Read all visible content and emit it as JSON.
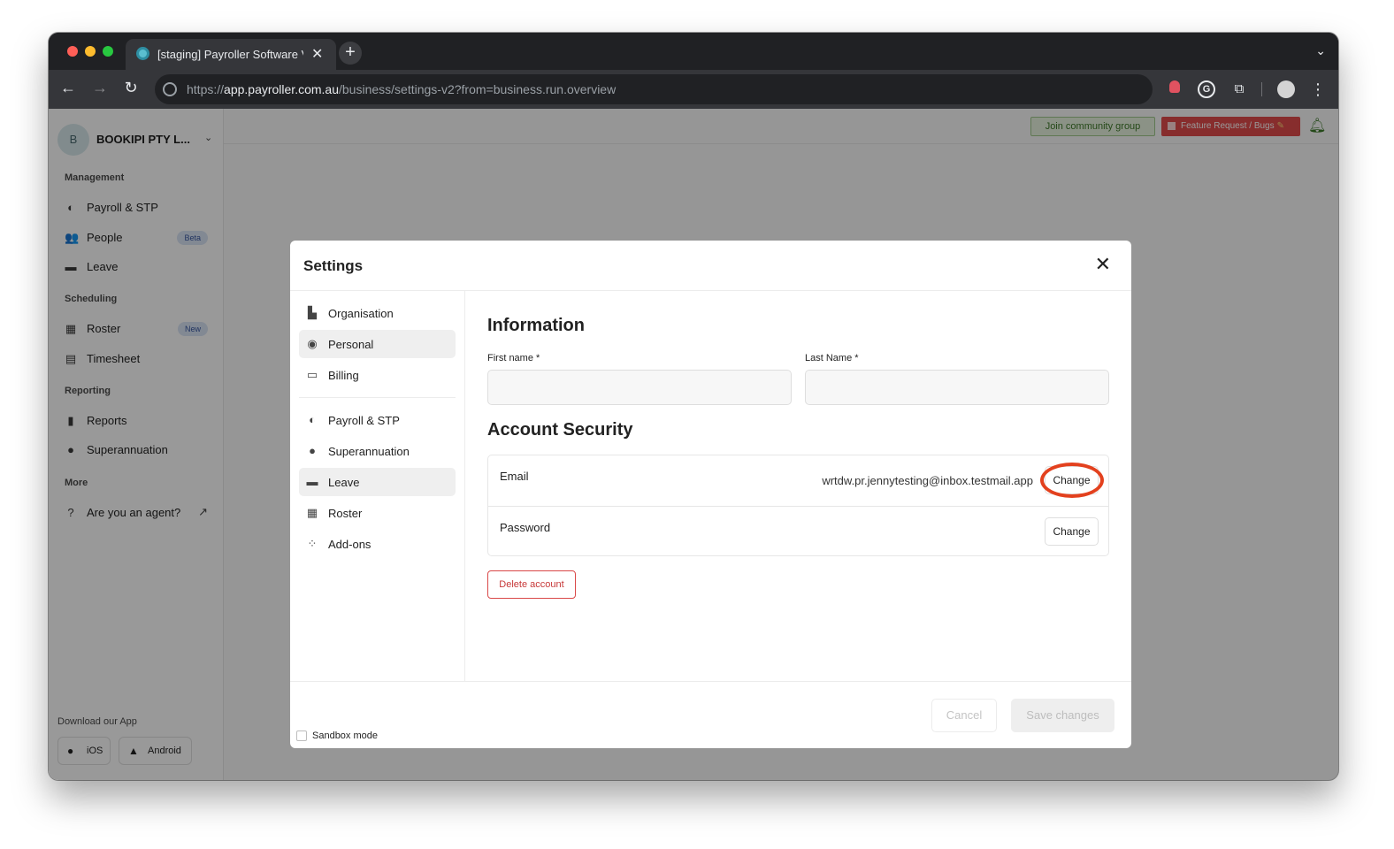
{
  "browser": {
    "tab_title": "[staging] Payroller Software V",
    "url_prefix": "https://",
    "url_host": "app.payroller.com.au",
    "url_path": "/business/settings-v2?from=business.run.overview",
    "extensions": [
      "record-icon",
      "grammarly-icon",
      "puzzle-icon",
      "avatar-icon",
      "menu-icon"
    ]
  },
  "sidebar": {
    "business_initial": "B",
    "business_name": "BOOKIPI PTY L...",
    "sections": {
      "management": "Management",
      "scheduling": "Scheduling",
      "reporting": "Reporting",
      "more": "More"
    },
    "items": [
      {
        "label": "Payroll & STP",
        "icon": "payroll-icon"
      },
      {
        "label": "People",
        "icon": "people-icon",
        "badge": "Beta"
      },
      {
        "label": "Leave",
        "icon": "leave-icon"
      },
      {
        "label": "Roster",
        "icon": "calendar-icon",
        "badge": "New"
      },
      {
        "label": "Timesheet",
        "icon": "clipboard-icon"
      },
      {
        "label": "Reports",
        "icon": "report-icon"
      },
      {
        "label": "Superannuation",
        "icon": "piggy-bank-icon"
      },
      {
        "label": "Are you an agent?",
        "icon": "help-icon"
      }
    ],
    "download_title": "Download our App",
    "ios_label": "iOS",
    "android_label": "Android"
  },
  "topbar": {
    "community_label": "Join community group",
    "feature_label": "Feature Request / Bugs"
  },
  "modal": {
    "title": "Settings",
    "nav": [
      {
        "label": "Organisation"
      },
      {
        "label": "Personal",
        "active": true
      },
      {
        "label": "Billing"
      },
      {
        "label": "Payroll & STP"
      },
      {
        "label": "Superannuation"
      },
      {
        "label": "Leave",
        "active": true
      },
      {
        "label": "Roster"
      },
      {
        "label": "Add-ons"
      }
    ],
    "information_heading": "Information",
    "first_name_label": "First name *",
    "first_name_value": "",
    "last_name_label": "Last Name *",
    "last_name_value": "",
    "security_heading": "Account Security",
    "email_label": "Email",
    "email_value": "wrtdw.pr.jennytesting@inbox.testmail.app",
    "email_change": "Change",
    "password_label": "Password",
    "password_change": "Change",
    "delete_label": "Delete account",
    "sandbox_label": "Sandbox mode",
    "cancel_label": "Cancel",
    "save_label": "Save changes"
  },
  "colors": {
    "highlight": "#e3411e",
    "danger": "#c73838",
    "community": "#3e7a2a",
    "feature": "#e14b4b"
  }
}
